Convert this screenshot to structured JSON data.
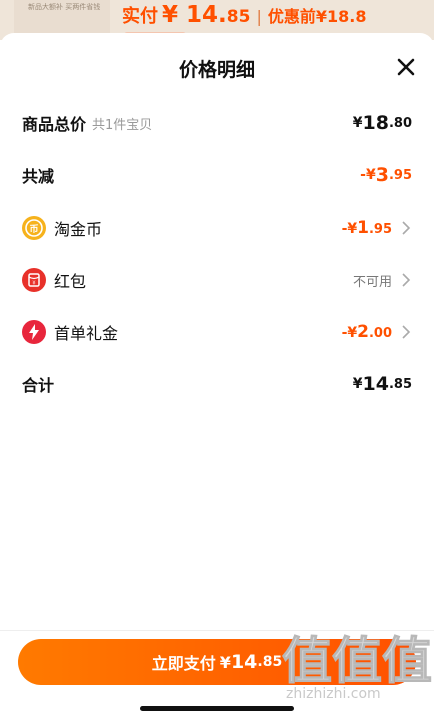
{
  "background": {
    "thumb_line": "新品大额补 买两件省钱",
    "price_label": "实付",
    "price_currency": "¥",
    "price_int": "14.",
    "price_dec": "85",
    "separator": "|",
    "original_label": "优惠前",
    "original_price": "¥18.8"
  },
  "sheet": {
    "title": "价格明细",
    "close_icon": "close-icon"
  },
  "rows": {
    "total": {
      "label": "商品总价",
      "sub": "共1件宝贝",
      "cur": "¥",
      "int": "18",
      "dec": ".80"
    },
    "reduced": {
      "label": "共减",
      "cur": "-¥",
      "int": "3",
      "dec": ".95"
    },
    "coins": {
      "label": "淘金币",
      "cur": "-¥",
      "int": "1",
      "dec": ".95",
      "icon": "coin-icon"
    },
    "redpacket": {
      "label": "红包",
      "value": "不可用",
      "icon": "red-packet-icon"
    },
    "first_order": {
      "label": "首单礼金",
      "cur": "-¥",
      "int": "2",
      "dec": ".00",
      "icon": "lightning-icon"
    },
    "sum": {
      "label": "合计",
      "cur": "¥",
      "int": "14",
      "dec": ".85"
    }
  },
  "pay_button": {
    "label": "立即支付",
    "cur": "¥",
    "int": "14",
    "dec": ".85"
  },
  "watermark": {
    "glyphs": "值值值",
    "url": "zhizhizhi.com"
  },
  "colors": {
    "accent": "#ff5000",
    "text": "#111111",
    "muted": "#999999"
  }
}
